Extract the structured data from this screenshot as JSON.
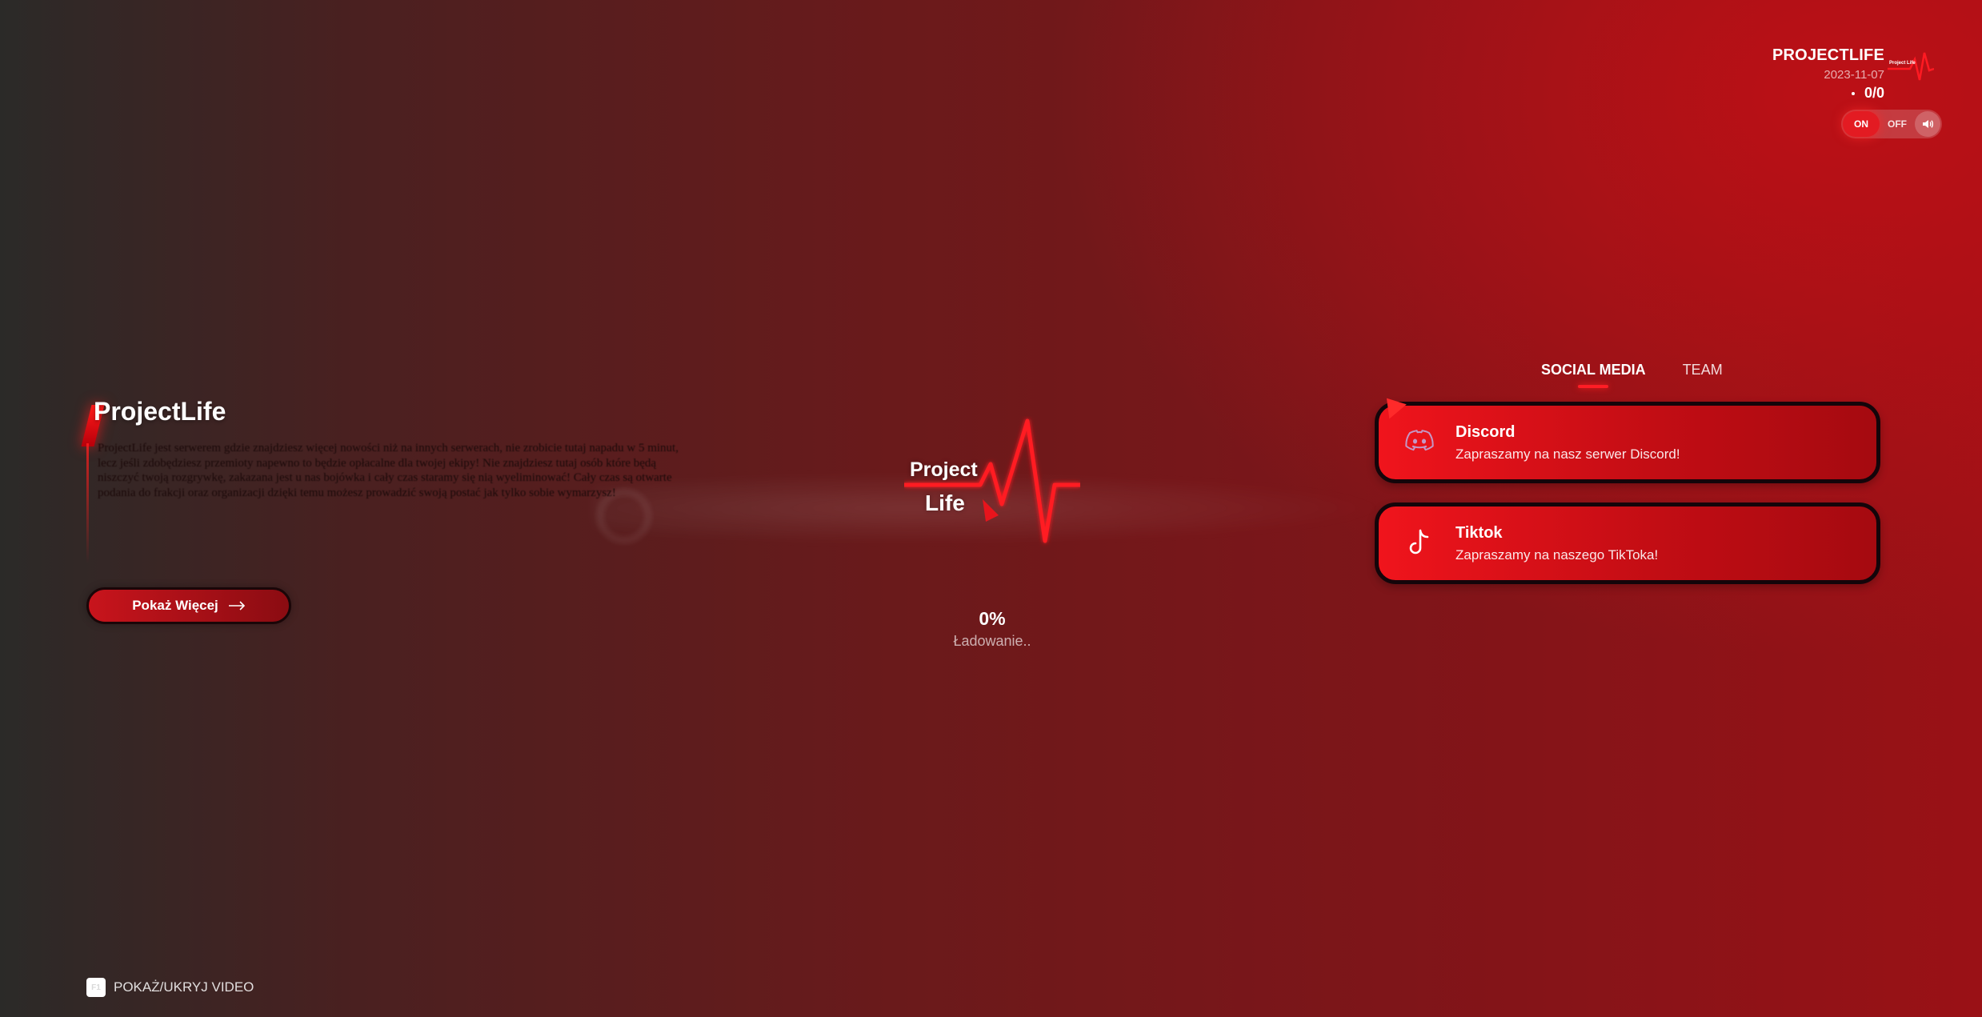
{
  "header": {
    "server_name": "PROJECTLIFE",
    "date": "2023-11-07",
    "players": "0/0",
    "mini_logo_text": "Project Life"
  },
  "audio": {
    "on_label": "ON",
    "off_label": "OFF",
    "icon": "speaker-icon",
    "state": "on"
  },
  "about": {
    "title": "ProjectLife",
    "text": "ProjectLife jest serwerem gdzie znajdziesz więcej nowości niż na innych serwerach, nie zrobicie tutaj napadu w 5 minut, lecz jeśli zdobędziesz przemioty napewno to będzie opłacalne dla twojej ekipy! Nie znajdziesz tutaj osób które będą niszczyć twoją rozgrywkę, zakazana jest u nas bojówka i cały czas staramy się nią wyeliminować! Cały czas są otwarte podania do frakcji oraz organizacji dzięki temu możesz prowadzić swoją postać jak tylko sobie wymarzysz!",
    "button_label": "Pokaż Więcej",
    "button_icon": "arrow-right-icon"
  },
  "logo": {
    "word1": "Project",
    "word2": "Life"
  },
  "loading": {
    "percent": "0%",
    "label": "Ładowanie.."
  },
  "social": {
    "tabs": [
      {
        "label": "SOCIAL MEDIA",
        "active": true
      },
      {
        "label": "TEAM",
        "active": false
      }
    ],
    "cards": [
      {
        "title": "Discord",
        "subtitle": "Zapraszamy na nasz serwer Discord!",
        "icon": "discord-icon"
      },
      {
        "title": "Tiktok",
        "subtitle": "Zapraszamy na naszego TikToka!",
        "icon": "tiktok-icon"
      }
    ]
  },
  "footer": {
    "key": "F1",
    "label": "POKAŻ/UKRYJ VIDEO"
  },
  "colors": {
    "accent": "#e31b22",
    "card_start": "#f0141c",
    "card_end": "#a50a10"
  }
}
